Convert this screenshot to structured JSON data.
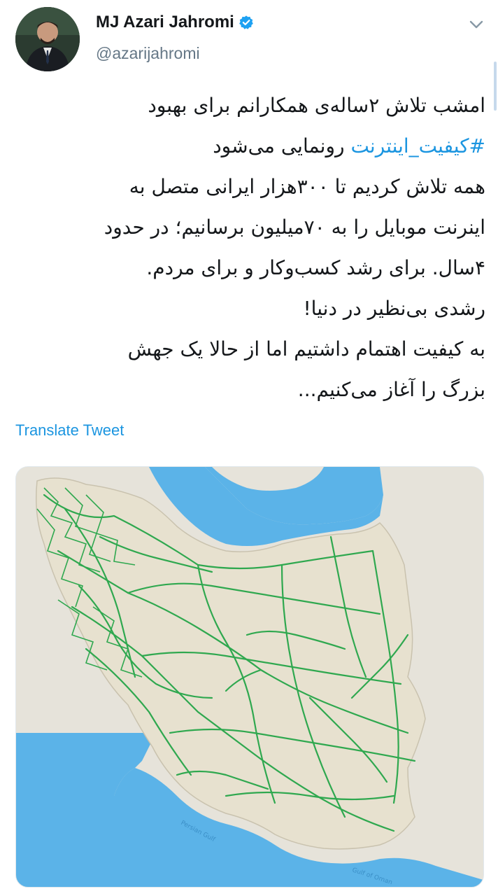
{
  "author": {
    "display_name": "MJ Azari Jahromi",
    "handle": "@azarijahromi",
    "verified": true,
    "avatar_icon": "profile-photo"
  },
  "menu_icon": "chevron-down-icon",
  "tweet": {
    "lines": [
      "امشب تلاش ۲ساله‌ی همکارانم برای بهبود",
      "روندمایی می‌شود",
      "همه تلاش کردیم تا ۳۰۰هزار ایرانی متصل به",
      "اینرنت موبایل را به ۷۰میلیون برسانیم؛ در حدود",
      "۴سال. برای رشد کسب‌وکار و برای مردم.",
      "رشدی بی‌نظیر در دنیا!",
      "به کیفیت اهتمام داشتیم اما از حالا یک جهش",
      "بزرگ را آغاز می‌کنیم..."
    ],
    "hashtag": "#کیفیت_اینترنت",
    "line2_text": "رونمایی می‌شود"
  },
  "translate_label": "Translate Tweet",
  "media": {
    "description_labels": {
      "water_label_1": "Persian Gulf",
      "water_label_2": "Gulf of Oman"
    },
    "colors": {
      "water": "#5bb3e8",
      "land": "#e6e3da",
      "network": "#2fa84f"
    }
  },
  "colors": {
    "link": "#1b95e0",
    "secondary_text": "#657786",
    "verified": "#1da1f2"
  }
}
